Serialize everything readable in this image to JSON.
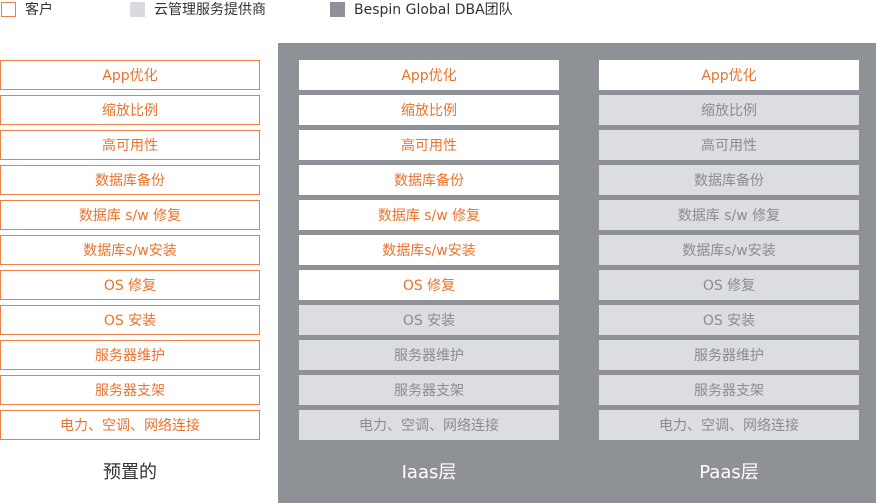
{
  "legend": {
    "customer": "客户",
    "provider": "云管理服务提供商",
    "bespin": "Bespin Global DBA团队"
  },
  "colors": {
    "customer_border": "#e8804a",
    "customer_text": "#e8732e",
    "provider_fill": "#dcdde0",
    "provider_text": "#8a8c90",
    "bespin_fill": "#8e9196"
  },
  "columns": [
    {
      "title": "预置的",
      "cells": [
        {
          "label": "App优化",
          "owner": "customer"
        },
        {
          "label": "缩放比例",
          "owner": "customer"
        },
        {
          "label": "高可用性",
          "owner": "customer"
        },
        {
          "label": "数据库备份",
          "owner": "customer"
        },
        {
          "label": "数据库 s/w 修复",
          "owner": "customer"
        },
        {
          "label": "数据库s/w安装",
          "owner": "customer"
        },
        {
          "label": "OS 修复",
          "owner": "customer"
        },
        {
          "label": "OS 安装",
          "owner": "customer"
        },
        {
          "label": "服务器维护",
          "owner": "customer"
        },
        {
          "label": "服务器支架",
          "owner": "customer"
        },
        {
          "label": "电力、空调、网络连接",
          "owner": "customer"
        }
      ]
    },
    {
      "title": "Iaas层",
      "cells": [
        {
          "label": "App优化",
          "owner": "bespin"
        },
        {
          "label": "缩放比例",
          "owner": "bespin"
        },
        {
          "label": "高可用性",
          "owner": "bespin"
        },
        {
          "label": "数据库备份",
          "owner": "bespin"
        },
        {
          "label": "数据库 s/w 修复",
          "owner": "bespin"
        },
        {
          "label": "数据库s/w安装",
          "owner": "bespin"
        },
        {
          "label": "OS 修复",
          "owner": "bespin"
        },
        {
          "label": "OS 安装",
          "owner": "provider"
        },
        {
          "label": "服务器维护",
          "owner": "provider"
        },
        {
          "label": "服务器支架",
          "owner": "provider"
        },
        {
          "label": "电力、空调、网络连接",
          "owner": "provider"
        }
      ]
    },
    {
      "title": "Paas层",
      "cells": [
        {
          "label": "App优化",
          "owner": "bespin"
        },
        {
          "label": "缩放比例",
          "owner": "provider"
        },
        {
          "label": "高可用性",
          "owner": "provider"
        },
        {
          "label": "数据库备份",
          "owner": "provider"
        },
        {
          "label": "数据库 s/w 修复",
          "owner": "provider"
        },
        {
          "label": "数据库s/w安装",
          "owner": "provider"
        },
        {
          "label": "OS 修复",
          "owner": "provider"
        },
        {
          "label": "OS 安装",
          "owner": "provider"
        },
        {
          "label": "服务器维护",
          "owner": "provider"
        },
        {
          "label": "服务器支架",
          "owner": "provider"
        },
        {
          "label": "电力、空调、网络连接",
          "owner": "provider"
        }
      ]
    }
  ]
}
